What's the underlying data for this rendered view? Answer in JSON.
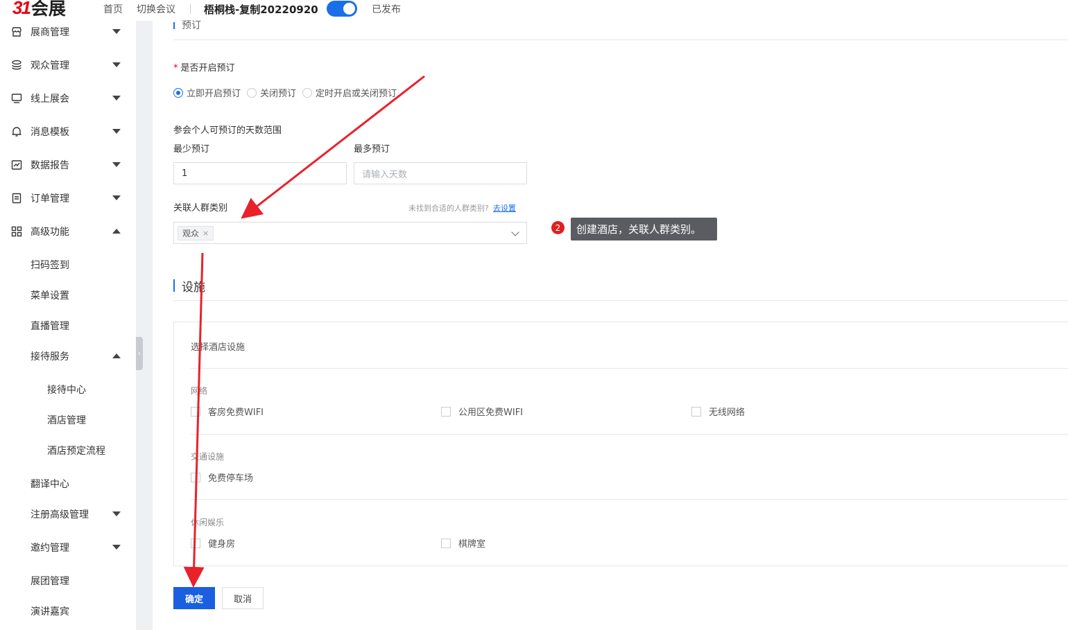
{
  "header": {
    "logo_mark": "31",
    "logo_text": "会展",
    "nav_home": "首页",
    "nav_switch": "切换会议",
    "conference_name": "梧桐栈-复制20220920",
    "status": "已发布"
  },
  "sidebar": {
    "items": [
      {
        "label": "展商管理"
      },
      {
        "label": "观众管理"
      },
      {
        "label": "线上展会"
      },
      {
        "label": "消息模板"
      },
      {
        "label": "数据报告"
      },
      {
        "label": "订单管理"
      },
      {
        "label": "高级功能"
      },
      {
        "label": "扫码签到"
      },
      {
        "label": "菜单设置"
      },
      {
        "label": "直播管理"
      },
      {
        "label": "接待服务"
      },
      {
        "label": "接待中心"
      },
      {
        "label": "酒店管理"
      },
      {
        "label": "酒店预定流程"
      },
      {
        "label": "翻译中心"
      },
      {
        "label": "注册高级管理"
      },
      {
        "label": "邀约管理"
      },
      {
        "label": "展团管理"
      },
      {
        "label": "演讲嘉宾"
      }
    ]
  },
  "form": {
    "top_section_partial": "预订",
    "enable_label": "是否开启预订",
    "required_mark": "*",
    "radios": [
      "立即开启预订",
      "关闭预订",
      "定时开启或关闭预订"
    ],
    "range_label": "参会个人可预订的天数范围",
    "min_label": "最少预订",
    "min_value": "1",
    "max_label": "最多预订",
    "max_placeholder": "请输入天数",
    "group_label": "关联人群类别",
    "group_hint": "未找到合适的人群类别?",
    "group_hint_link": "去设置",
    "group_tag": "观众",
    "tag_close": "×"
  },
  "facilities": {
    "title": "设施",
    "box_title": "选择酒店设施",
    "groups": [
      {
        "title": "网络",
        "items": [
          "客房免费WIFI",
          "公用区免费WIFI",
          "无线网络"
        ]
      },
      {
        "title": "交通设施",
        "items": [
          "免费停车场"
        ]
      },
      {
        "title": "休闲娱乐",
        "items": [
          "健身房",
          "棋牌室"
        ]
      }
    ]
  },
  "actions": {
    "confirm": "确定",
    "cancel": "取消"
  },
  "annotation": {
    "number": "2",
    "text": "创建酒店，关联人群类别。",
    "arrow_color": "#e8212b"
  }
}
